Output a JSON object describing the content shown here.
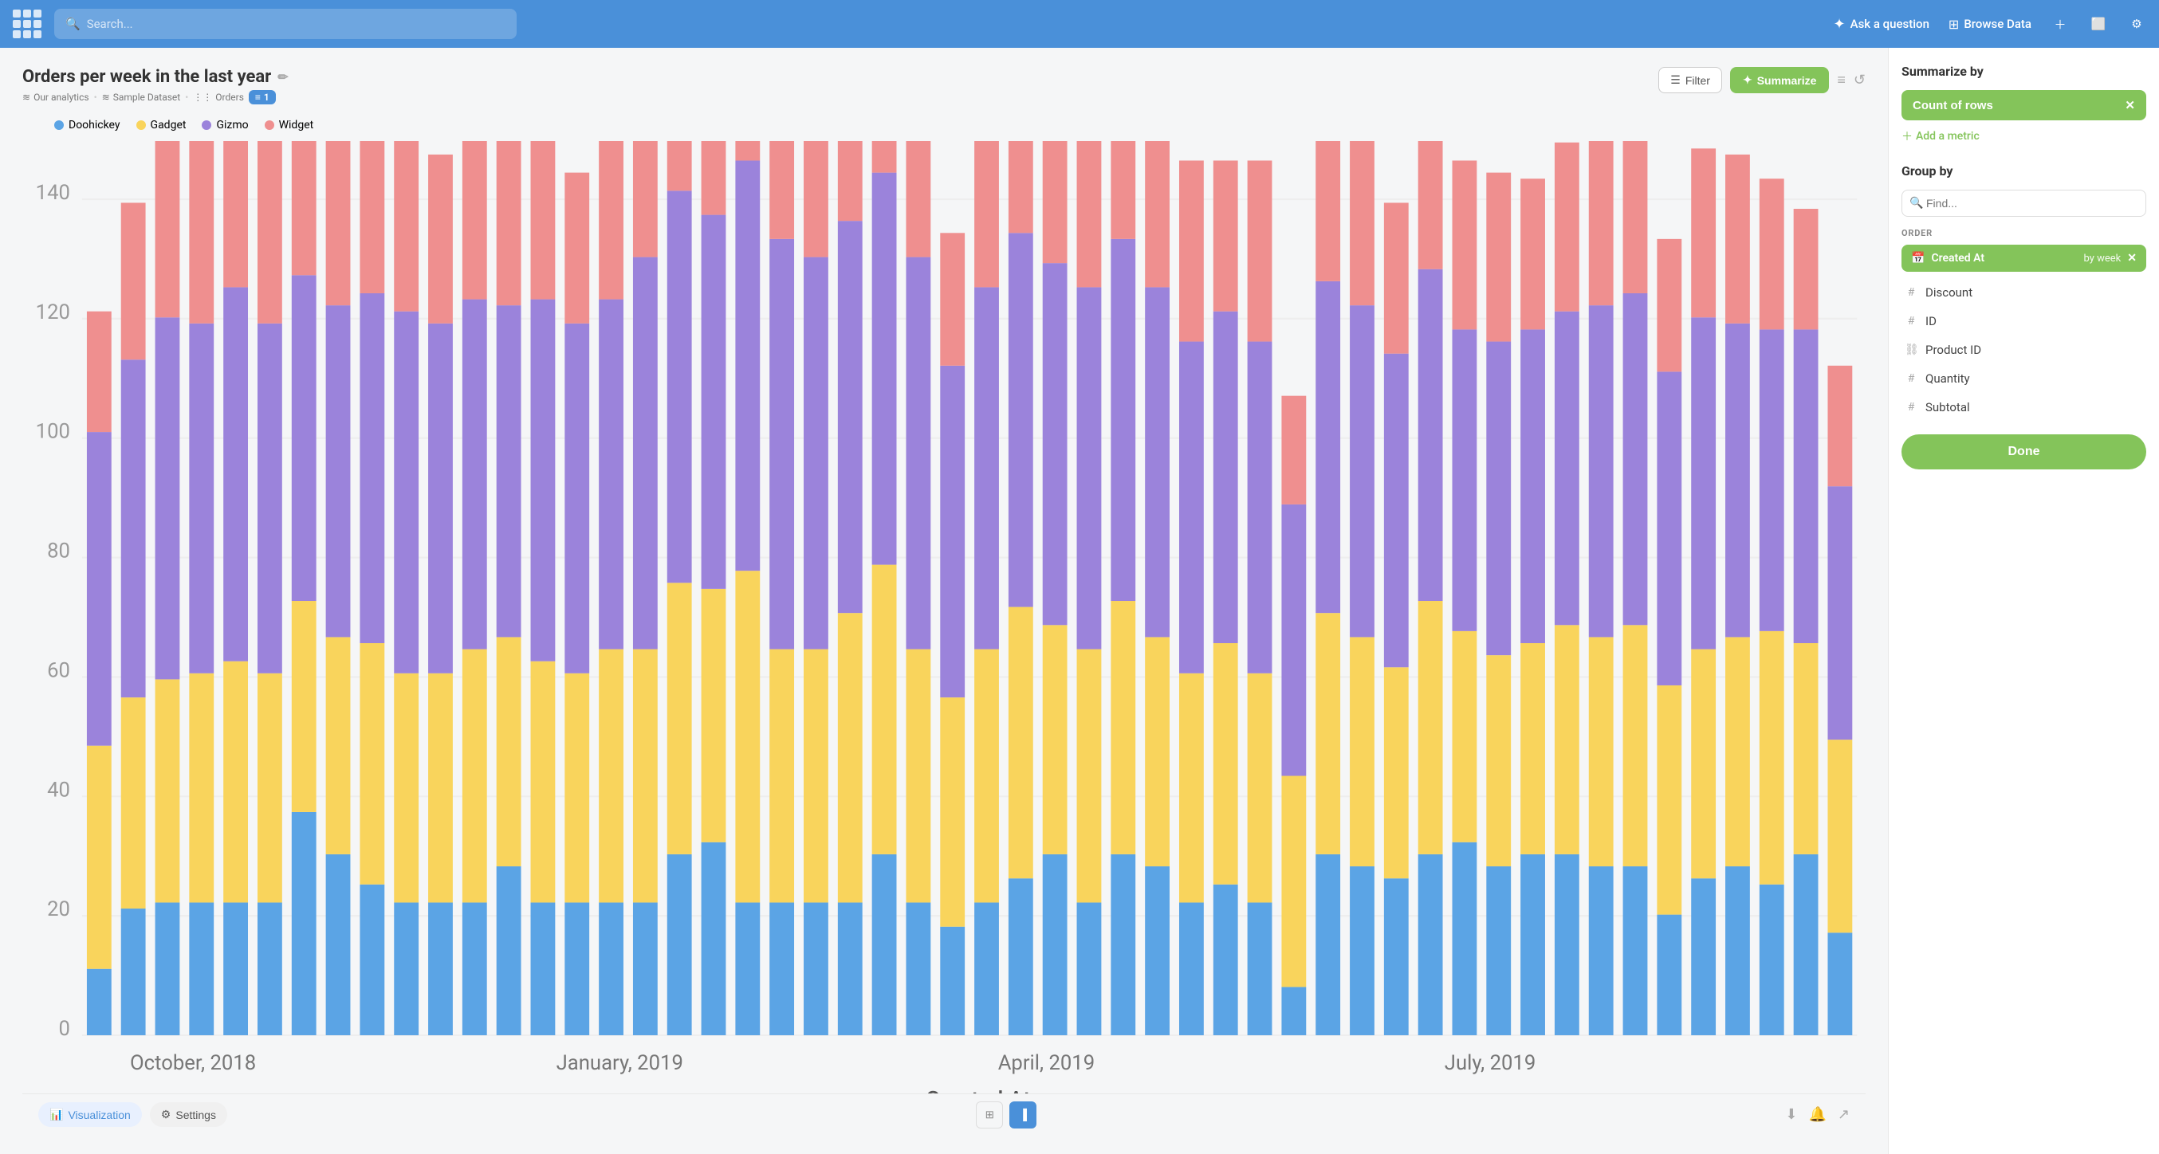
{
  "topnav": {
    "search_placeholder": "Search...",
    "ask_a_question": "Ask a question",
    "browse_data": "Browse Data"
  },
  "chart": {
    "title": "Orders per week in the last year",
    "breadcrumb": {
      "analytics": "Our analytics",
      "dataset": "Sample Dataset",
      "table": "Orders"
    },
    "filter_count": "1",
    "legend": [
      {
        "label": "Doohickey",
        "color": "#5ba4e5"
      },
      {
        "label": "Gadget",
        "color": "#f9d45c"
      },
      {
        "label": "Gizmo",
        "color": "#9b83db"
      },
      {
        "label": "Widget",
        "color": "#ef8f8f"
      }
    ],
    "x_axis_label": "Created At",
    "y_axis_ticks": [
      "0",
      "20",
      "40",
      "60",
      "80",
      "100",
      "120",
      "140"
    ],
    "x_axis_ticks": [
      "October, 2018",
      "January, 2019",
      "April, 2019",
      "July, 2019"
    ]
  },
  "toolbar": {
    "filter_label": "Filter",
    "summarize_label": "Summarize"
  },
  "bottom_bar": {
    "visualization_label": "Visualization",
    "settings_label": "Settings"
  },
  "sidebar": {
    "summarize_by_title": "Summarize by",
    "count_of_rows_label": "Count of rows",
    "add_metric_label": "Add a metric",
    "group_by_title": "Group by",
    "find_placeholder": "Find...",
    "order_label": "ORDER",
    "created_at_label": "Created At",
    "by_week_label": "by week",
    "group_items": [
      {
        "label": "Discount",
        "icon": "hash"
      },
      {
        "label": "ID",
        "icon": "hash"
      },
      {
        "label": "Product ID",
        "icon": "link"
      },
      {
        "label": "Quantity",
        "icon": "hash"
      },
      {
        "label": "Subtotal",
        "icon": "hash"
      }
    ],
    "done_label": "Done"
  }
}
